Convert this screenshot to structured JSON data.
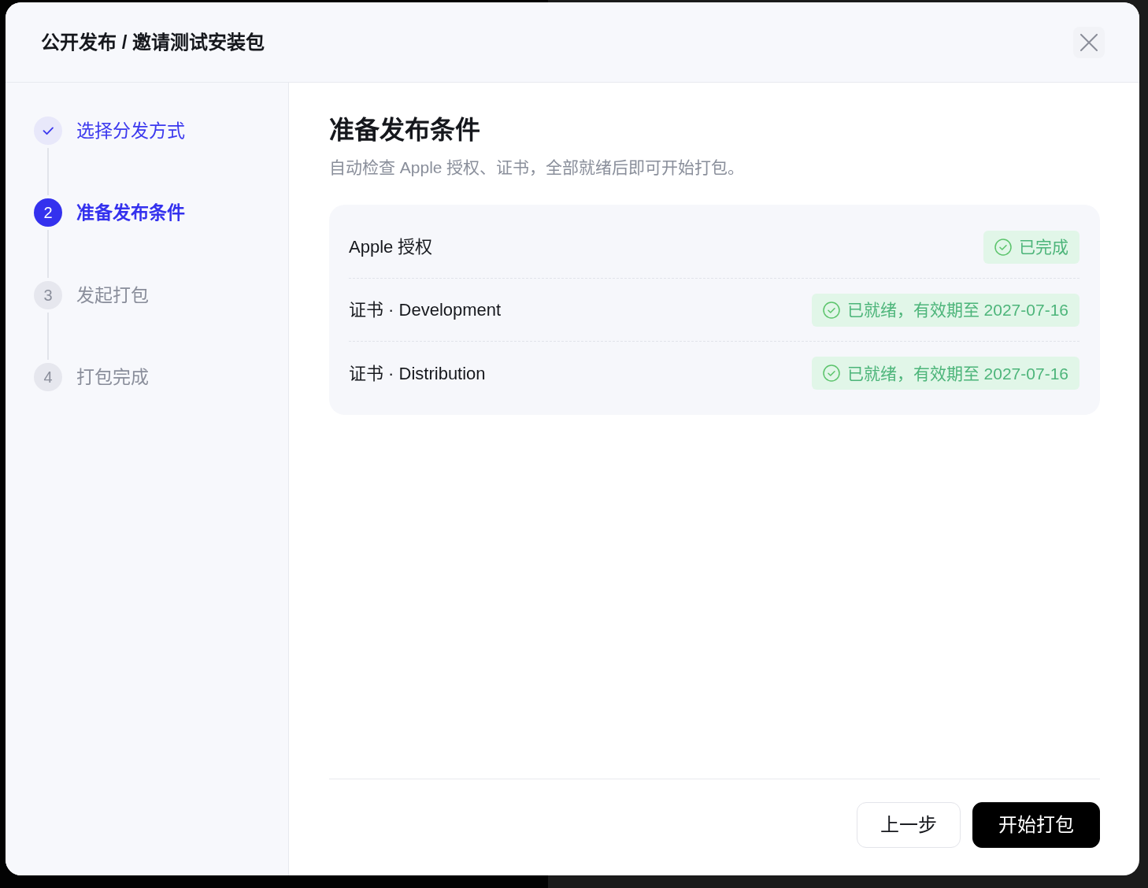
{
  "dialog": {
    "title": "公开发布 / 邀请测试安装包"
  },
  "steps": [
    {
      "label": "选择分发方式",
      "completed": true,
      "selected": false
    },
    {
      "number": "2",
      "label": "准备发布条件",
      "completed": false,
      "selected": true
    },
    {
      "number": "3",
      "label": "发起打包",
      "completed": false,
      "selected": false
    },
    {
      "number": "4",
      "label": "打包完成",
      "completed": false,
      "selected": false
    }
  ],
  "content": {
    "heading": "准备发布条件",
    "description": "自动检查 Apple 授权、证书，全部就绪后即可开始打包。",
    "checks": [
      {
        "label": "Apple 授权",
        "status": "已完成",
        "passed": true
      },
      {
        "label": "证书 · Development",
        "status": "已就绪，有效期至 2027-07-16",
        "passed": true
      },
      {
        "label": "证书 · Distribution",
        "status": "已就绪，有效期至 2027-07-16",
        "passed": true
      }
    ]
  },
  "footer": {
    "buttons": [
      {
        "label": "上一步",
        "kind": "secondary"
      },
      {
        "label": "开始打包",
        "kind": "primary"
      }
    ]
  }
}
